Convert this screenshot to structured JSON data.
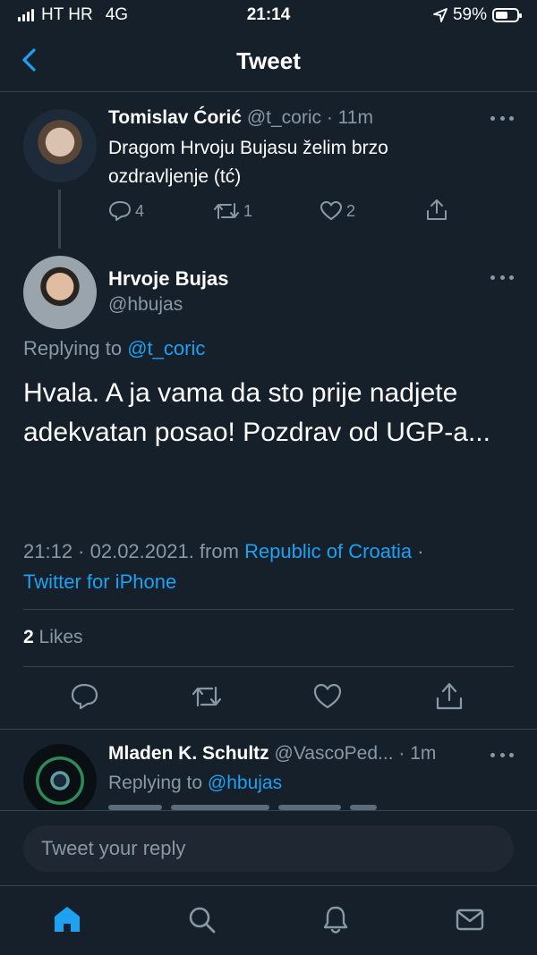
{
  "status_bar": {
    "carrier": "HT HR",
    "network": "4G",
    "time": "21:14",
    "battery": "59%",
    "battery_level": 0.59
  },
  "header": {
    "title": "Tweet"
  },
  "tweet_parent": {
    "name": "Tomislav Ćorić",
    "handle": "@t_coric",
    "time": "· 11m",
    "text": "Dragom Hrvoju Bujasu želim brzo ozdravljenje (tć)",
    "replies": "4",
    "retweets": "1",
    "likes": "2"
  },
  "tweet_main": {
    "name": "Hrvoje Bujas",
    "handle": "@hbujas",
    "replying_prefix": "Replying to",
    "replying_to": "@t_coric",
    "text": "Hvala. A ja vama da sto prije nadjete adekvatan posao! Pozdrav od UGP-a...",
    "timestamp": "21:12 · 02.02.2021. from",
    "location": "Republic of Croatia",
    "separator": "·",
    "source": "Twitter for iPhone",
    "likes_count": "2",
    "likes_label": "Likes"
  },
  "tweet_reply": {
    "name": "Mladen K. Schultz",
    "handle": "@VascoPed...",
    "time": "· 1m",
    "replying_prefix": "Replying to",
    "replying_to": "@hbujas"
  },
  "reply_box": {
    "placeholder": "Tweet your reply"
  },
  "tab_bar": {
    "items": [
      "home-icon",
      "search-icon",
      "notifications-icon",
      "messages-icon"
    ],
    "active_color": "#1da1f2"
  },
  "colors": {
    "background": "#15202b",
    "accent": "#1da1f2",
    "muted": "#8899a6",
    "divider": "#38444d"
  }
}
